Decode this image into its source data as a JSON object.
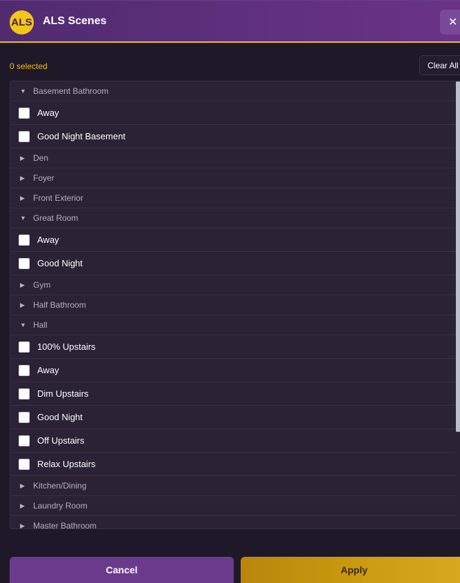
{
  "header": {
    "logo_text": "ALS",
    "title": "ALS Scenes",
    "close_label": "✕"
  },
  "toolbar": {
    "selected_count": "0 selected",
    "clear_all_label": "Clear All"
  },
  "list": [
    {
      "type": "group",
      "label": "Basement Bathroom",
      "expanded": true
    },
    {
      "type": "item",
      "label": "Away",
      "checked": false
    },
    {
      "type": "item",
      "label": "Good Night Basement",
      "checked": false
    },
    {
      "type": "group",
      "label": "Den",
      "expanded": false
    },
    {
      "type": "group",
      "label": "Foyer",
      "expanded": false
    },
    {
      "type": "group",
      "label": "Front Exterior",
      "expanded": false
    },
    {
      "type": "group",
      "label": "Great Room",
      "expanded": true
    },
    {
      "type": "item",
      "label": "Away",
      "checked": false
    },
    {
      "type": "item",
      "label": "Good Night",
      "checked": false
    },
    {
      "type": "group",
      "label": "Gym",
      "expanded": false
    },
    {
      "type": "group",
      "label": "Half Bathroom",
      "expanded": false
    },
    {
      "type": "group",
      "label": "Hall",
      "expanded": true
    },
    {
      "type": "item",
      "label": "100% Upstairs",
      "checked": false
    },
    {
      "type": "item",
      "label": "Away",
      "checked": false
    },
    {
      "type": "item",
      "label": "Dim Upstairs",
      "checked": false
    },
    {
      "type": "item",
      "label": "Good Night",
      "checked": false
    },
    {
      "type": "item",
      "label": "Off Upstairs",
      "checked": false
    },
    {
      "type": "item",
      "label": "Relax Upstairs",
      "checked": false
    },
    {
      "type": "group",
      "label": "Kitchen/Dining",
      "expanded": false
    },
    {
      "type": "group",
      "label": "Laundry Room",
      "expanded": false
    },
    {
      "type": "group",
      "label": "Master Bathroom",
      "expanded": false
    }
  ],
  "footer": {
    "cancel_label": "Cancel",
    "apply_label": "Apply"
  },
  "colors": {
    "accent": "#f0c020",
    "header_bg": "#61307f",
    "panel_bg": "#2b2236",
    "cancel_bg": "#6b3a8d",
    "apply_bg": "#c9990f"
  },
  "icons": {
    "expanded": "caret-down-icon",
    "collapsed": "caret-right-icon",
    "close": "close-icon"
  }
}
